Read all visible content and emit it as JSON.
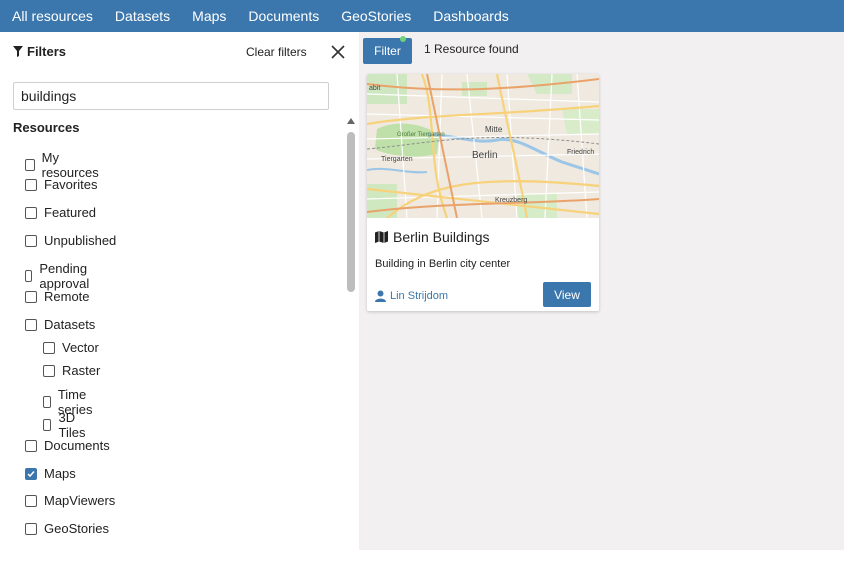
{
  "nav": {
    "items": [
      "All resources",
      "Datasets",
      "Maps",
      "Documents",
      "GeoStories",
      "Dashboards"
    ]
  },
  "sidebar": {
    "title": "Filters",
    "clear_label": "Clear filters",
    "search": {
      "value": "buildings"
    },
    "resources_heading": "Resources",
    "filters": [
      {
        "label": "My resources",
        "checked": false
      },
      {
        "label": "Favorites",
        "checked": false
      },
      {
        "label": "Featured",
        "checked": false
      },
      {
        "label": "Unpublished",
        "checked": false
      },
      {
        "label": "Pending approval",
        "checked": false
      },
      {
        "label": "Remote",
        "checked": false
      },
      {
        "label": "Datasets",
        "checked": false
      },
      {
        "label": "Vector",
        "checked": false
      },
      {
        "label": "Raster",
        "checked": false
      },
      {
        "label": "Time series",
        "checked": false
      },
      {
        "label": "3D Tiles",
        "checked": false
      },
      {
        "label": "Documents",
        "checked": false
      },
      {
        "label": "Maps",
        "checked": true
      },
      {
        "label": "MapViewers",
        "checked": false
      },
      {
        "label": "GeoStories",
        "checked": false
      }
    ]
  },
  "main": {
    "filter_button": "Filter",
    "result_count": "1 Resource found",
    "card": {
      "title": "Berlin Buildings",
      "description": "Building in Berlin city center",
      "author": "Lin Strijdom",
      "view_label": "View",
      "map_labels": [
        "abit",
        "Mitte",
        "Großer Tiergarten",
        "Tiergarten",
        "Berlin",
        "Friedrich",
        "Kreuzberg"
      ]
    }
  },
  "colors": {
    "accent": "#3b77ac",
    "main_bg": "#f2f0f0",
    "badge": "#6fd17a"
  }
}
